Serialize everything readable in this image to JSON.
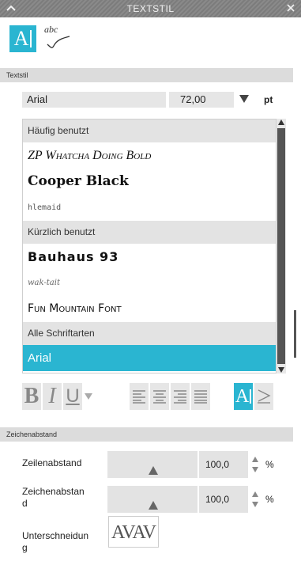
{
  "window": {
    "title": "TEXTSTIL"
  },
  "modes": {
    "text_glyph": "A",
    "handwriting_glyph": "abc"
  },
  "sections": {
    "textstil": "Textstil",
    "zeichenabstand": "Zeichenabstand"
  },
  "font": {
    "name": "Arial",
    "size": "72,00",
    "unit": "pt"
  },
  "font_list": {
    "groups": {
      "frequent": "Häufig benutzt",
      "recent": "Kürzlich benutzt",
      "all": "Alle Schriftarten"
    },
    "frequent_items": [
      "ZP Whatcha Doing Bold",
      "Cooper Black",
      "hlemaid"
    ],
    "recent_items": [
      "Bauhaus 93",
      "wak-tait",
      "Fun Mountain Font"
    ],
    "all_items": [
      "Arial"
    ]
  },
  "style_toolbar": {
    "bold": "B",
    "italic": "I",
    "underline": "U",
    "text_mode": "A"
  },
  "spacing": {
    "line_label": "Zeilenabstand",
    "line_value": "100,0",
    "char_label_1": "Zeichenabstan",
    "char_label_2": "d",
    "char_value": "100,0",
    "percent": "%",
    "kern_label_1": "Unterschneidun",
    "kern_label_2": "g",
    "kern_sample": "AVAV"
  },
  "colors": {
    "accent": "#2ab5d1",
    "titlebar": "#808080"
  }
}
